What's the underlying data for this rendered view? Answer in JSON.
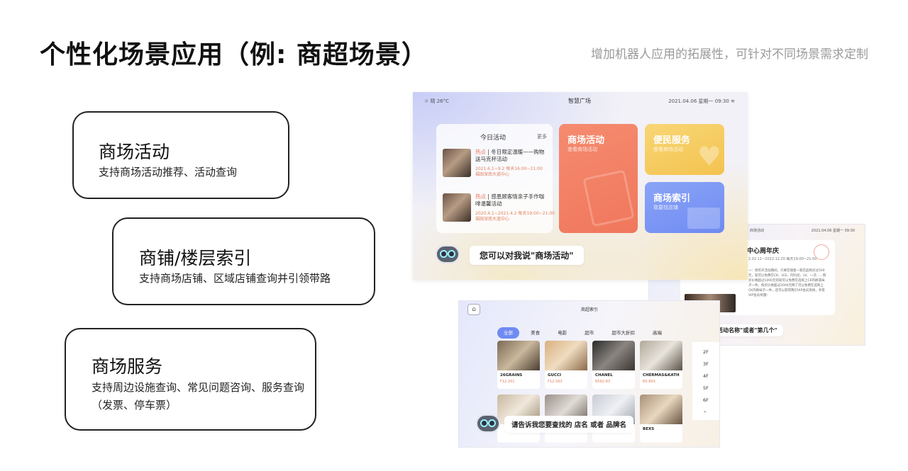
{
  "header": {
    "title": "个性化场景应用（例: 商超场景）",
    "subtitle": "增加机器人应用的拓展性，可针对不同场景需求定制"
  },
  "features": [
    {
      "title": "商场活动",
      "desc": "支持商场活动推荐、活动查询"
    },
    {
      "title": "商铺/楼层索引",
      "desc": "支持商场店铺、区域店铺查询并引领带路"
    },
    {
      "title": "商场服务",
      "desc": "支持周边设施查询、常见问题咨询、服务查询（发票、停车票）"
    }
  ],
  "main_screen": {
    "weather": "☼ 晴  26°C",
    "app_title": "智慧广场",
    "datetime": "2021.04.06  星期一  09:30",
    "today": {
      "title": "今日活动",
      "more": "更多",
      "items": [
        {
          "tag": "热点",
          "title": "冬日限定温暖——购物送马克杯活动",
          "date": "2021.6.1~9.2  每天16:00~21:00",
          "location": "福田深南大道中心"
        },
        {
          "tag": "热点",
          "title": "感恩顾客情亲子手作咖啡温馨活动",
          "date": "2020.4.1~2021.4.2  每天19:00~21:00",
          "location": "福田深南大道中心"
        }
      ]
    },
    "tiles": {
      "activity": {
        "title": "商场活动",
        "sub": "查看商场活动"
      },
      "service": {
        "title": "便民服务",
        "sub": "查看商场活动"
      },
      "index": {
        "title": "商场索引",
        "sub": "我要找店铺"
      }
    },
    "prompt": "您可以对我说\"商场活动\""
  },
  "event_screen": {
    "header_left": "商场活动",
    "header_right": "2021.04.06  星期一  09:30",
    "title": "中心周年庆",
    "date": "2.02.11~2022.12.20  每天19:00~21:00",
    "desc": "一：周年庆活动期间，只要在随意一家店品购买过500元，就可以免费在CK、LEE、阿玛尼、LV、一次……购买价格超过1000元的就可以免费在选购上CK内裤或袜子一件。购买价格超过2000元降了可以免费在选购上CK内裤袜子一件，还可以获得我们VIP会员资格，享受VIP会员待遇!",
    "prompt": "对我说\"活动名称\"或者\"第几个\""
  },
  "index_screen": {
    "title": "商超索引",
    "home_icon": "⌂",
    "chips": [
      "全部",
      "美食",
      "电影",
      "超市",
      "超市大折扣",
      "高端"
    ],
    "shops": [
      {
        "name": "26GRAINS",
        "code": "F12-201"
      },
      {
        "name": "GUCCI",
        "code": "F12-563"
      },
      {
        "name": "CHANEL",
        "code": "B562-83"
      },
      {
        "name": "CHERMAS&KATH",
        "code": "B5-893"
      },
      {
        "name": "",
        "code": ""
      },
      {
        "name": "",
        "code": ""
      },
      {
        "name": "",
        "code": ""
      },
      {
        "name": "BEXS",
        "code": ""
      }
    ],
    "floors": [
      "2F",
      "3F",
      "4F",
      "5F",
      "6F",
      "⌄"
    ],
    "prompt": "请告诉我您要查找的 店名 或者 品牌名"
  }
}
